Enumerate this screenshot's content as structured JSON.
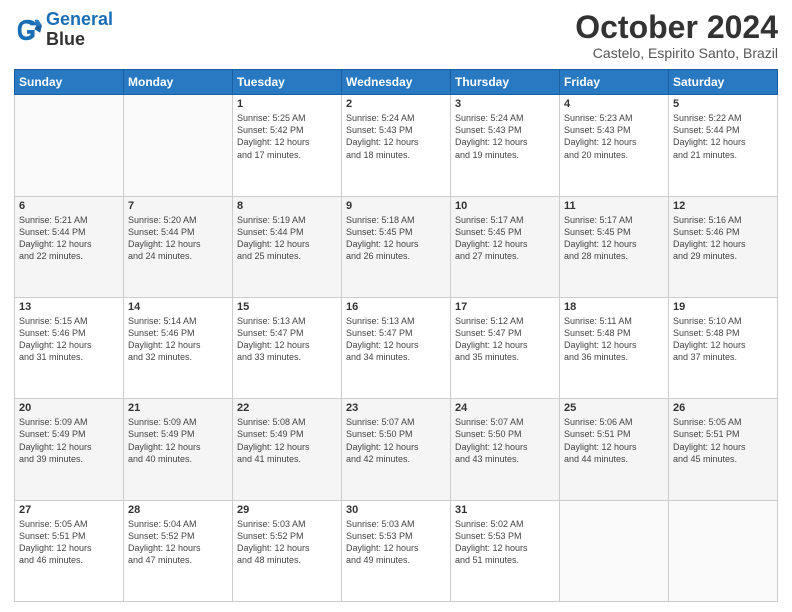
{
  "header": {
    "logo_line1": "General",
    "logo_line2": "Blue",
    "main_title": "October 2024",
    "subtitle": "Castelo, Espirito Santo, Brazil"
  },
  "days_of_week": [
    "Sunday",
    "Monday",
    "Tuesday",
    "Wednesday",
    "Thursday",
    "Friday",
    "Saturday"
  ],
  "weeks": [
    [
      {
        "day": "",
        "detail": ""
      },
      {
        "day": "",
        "detail": ""
      },
      {
        "day": "1",
        "detail": "Sunrise: 5:25 AM\nSunset: 5:42 PM\nDaylight: 12 hours\nand 17 minutes."
      },
      {
        "day": "2",
        "detail": "Sunrise: 5:24 AM\nSunset: 5:43 PM\nDaylight: 12 hours\nand 18 minutes."
      },
      {
        "day": "3",
        "detail": "Sunrise: 5:24 AM\nSunset: 5:43 PM\nDaylight: 12 hours\nand 19 minutes."
      },
      {
        "day": "4",
        "detail": "Sunrise: 5:23 AM\nSunset: 5:43 PM\nDaylight: 12 hours\nand 20 minutes."
      },
      {
        "day": "5",
        "detail": "Sunrise: 5:22 AM\nSunset: 5:44 PM\nDaylight: 12 hours\nand 21 minutes."
      }
    ],
    [
      {
        "day": "6",
        "detail": "Sunrise: 5:21 AM\nSunset: 5:44 PM\nDaylight: 12 hours\nand 22 minutes."
      },
      {
        "day": "7",
        "detail": "Sunrise: 5:20 AM\nSunset: 5:44 PM\nDaylight: 12 hours\nand 24 minutes."
      },
      {
        "day": "8",
        "detail": "Sunrise: 5:19 AM\nSunset: 5:44 PM\nDaylight: 12 hours\nand 25 minutes."
      },
      {
        "day": "9",
        "detail": "Sunrise: 5:18 AM\nSunset: 5:45 PM\nDaylight: 12 hours\nand 26 minutes."
      },
      {
        "day": "10",
        "detail": "Sunrise: 5:17 AM\nSunset: 5:45 PM\nDaylight: 12 hours\nand 27 minutes."
      },
      {
        "day": "11",
        "detail": "Sunrise: 5:17 AM\nSunset: 5:45 PM\nDaylight: 12 hours\nand 28 minutes."
      },
      {
        "day": "12",
        "detail": "Sunrise: 5:16 AM\nSunset: 5:46 PM\nDaylight: 12 hours\nand 29 minutes."
      }
    ],
    [
      {
        "day": "13",
        "detail": "Sunrise: 5:15 AM\nSunset: 5:46 PM\nDaylight: 12 hours\nand 31 minutes."
      },
      {
        "day": "14",
        "detail": "Sunrise: 5:14 AM\nSunset: 5:46 PM\nDaylight: 12 hours\nand 32 minutes."
      },
      {
        "day": "15",
        "detail": "Sunrise: 5:13 AM\nSunset: 5:47 PM\nDaylight: 12 hours\nand 33 minutes."
      },
      {
        "day": "16",
        "detail": "Sunrise: 5:13 AM\nSunset: 5:47 PM\nDaylight: 12 hours\nand 34 minutes."
      },
      {
        "day": "17",
        "detail": "Sunrise: 5:12 AM\nSunset: 5:47 PM\nDaylight: 12 hours\nand 35 minutes."
      },
      {
        "day": "18",
        "detail": "Sunrise: 5:11 AM\nSunset: 5:48 PM\nDaylight: 12 hours\nand 36 minutes."
      },
      {
        "day": "19",
        "detail": "Sunrise: 5:10 AM\nSunset: 5:48 PM\nDaylight: 12 hours\nand 37 minutes."
      }
    ],
    [
      {
        "day": "20",
        "detail": "Sunrise: 5:09 AM\nSunset: 5:49 PM\nDaylight: 12 hours\nand 39 minutes."
      },
      {
        "day": "21",
        "detail": "Sunrise: 5:09 AM\nSunset: 5:49 PM\nDaylight: 12 hours\nand 40 minutes."
      },
      {
        "day": "22",
        "detail": "Sunrise: 5:08 AM\nSunset: 5:49 PM\nDaylight: 12 hours\nand 41 minutes."
      },
      {
        "day": "23",
        "detail": "Sunrise: 5:07 AM\nSunset: 5:50 PM\nDaylight: 12 hours\nand 42 minutes."
      },
      {
        "day": "24",
        "detail": "Sunrise: 5:07 AM\nSunset: 5:50 PM\nDaylight: 12 hours\nand 43 minutes."
      },
      {
        "day": "25",
        "detail": "Sunrise: 5:06 AM\nSunset: 5:51 PM\nDaylight: 12 hours\nand 44 minutes."
      },
      {
        "day": "26",
        "detail": "Sunrise: 5:05 AM\nSunset: 5:51 PM\nDaylight: 12 hours\nand 45 minutes."
      }
    ],
    [
      {
        "day": "27",
        "detail": "Sunrise: 5:05 AM\nSunset: 5:51 PM\nDaylight: 12 hours\nand 46 minutes."
      },
      {
        "day": "28",
        "detail": "Sunrise: 5:04 AM\nSunset: 5:52 PM\nDaylight: 12 hours\nand 47 minutes."
      },
      {
        "day": "29",
        "detail": "Sunrise: 5:03 AM\nSunset: 5:52 PM\nDaylight: 12 hours\nand 48 minutes."
      },
      {
        "day": "30",
        "detail": "Sunrise: 5:03 AM\nSunset: 5:53 PM\nDaylight: 12 hours\nand 49 minutes."
      },
      {
        "day": "31",
        "detail": "Sunrise: 5:02 AM\nSunset: 5:53 PM\nDaylight: 12 hours\nand 51 minutes."
      },
      {
        "day": "",
        "detail": ""
      },
      {
        "day": "",
        "detail": ""
      }
    ]
  ]
}
